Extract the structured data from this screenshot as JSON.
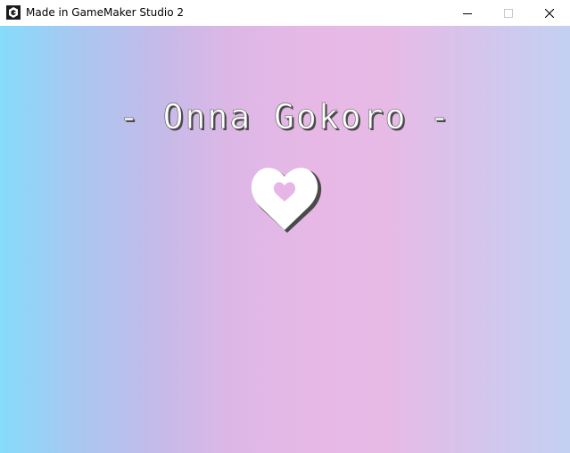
{
  "window": {
    "title": "Made in GameMaker Studio 2",
    "app_icon": "gamemaker-icon",
    "controls": {
      "minimize_icon": "minimize-icon",
      "maximize_icon": "maximize-icon",
      "close_icon": "close-icon"
    }
  },
  "game": {
    "title": "- Onna Gokoro -",
    "emblem_icon": "heart-icon",
    "colors": {
      "gradient_left": "#86dcfb",
      "gradient_middle": "#e7b8e5",
      "gradient_right": "#c3d0f3",
      "title_fill": "#ffffff",
      "title_shadow": "#4a4a4a",
      "heart_inner": "#e8b6e6"
    }
  }
}
